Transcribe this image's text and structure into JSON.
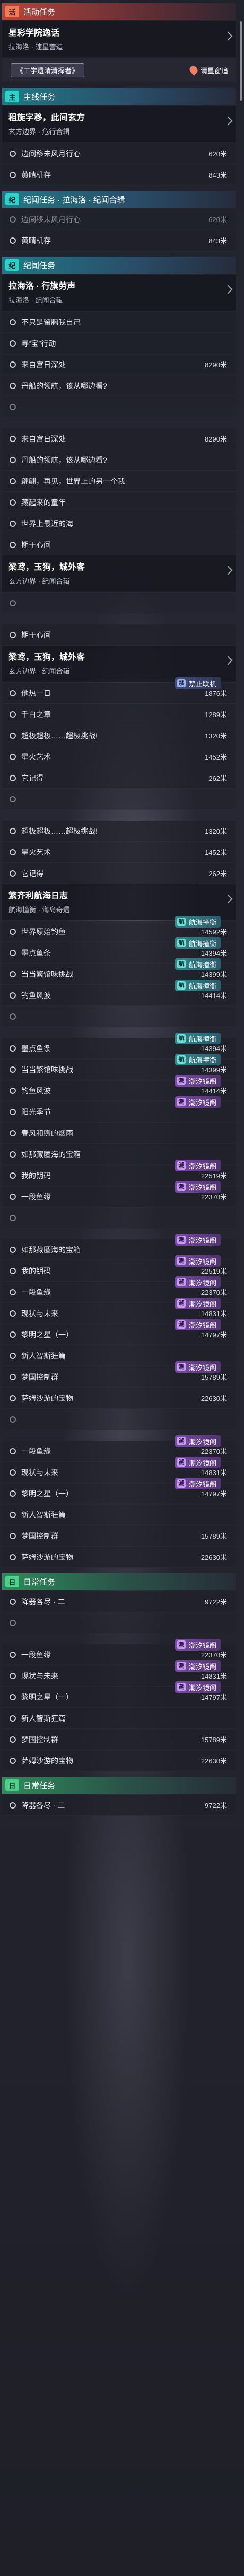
{
  "labels": {
    "event_header": "活动任务",
    "main_header": "主线任务",
    "story_header": "纪闻任务",
    "daily_header": "日常任务",
    "tag_event": "活",
    "tag_main": "主",
    "tag_story": "纪",
    "tag_daily": "日",
    "track_button": "请星窗追",
    "badge_net": "航海撞衡",
    "badge_tide": "潮汐镜阁",
    "badge_ban": "禁止联机"
  },
  "colors": {
    "event": "#b3463a",
    "main": "#1f7a86",
    "daily": "#2e8a5a",
    "accent_dot": "#c9ccd6"
  },
  "icons": {
    "obj_marker": "circle-outline-icon",
    "track": "map-pin-icon",
    "net": "compass-icon",
    "tide": "wave-icon",
    "ban": "lock-icon"
  },
  "rows": [
    {
      "kind": "hdr",
      "style": "event",
      "tag": "活",
      "text": "活动任务"
    },
    {
      "kind": "quest",
      "title": "星彩学院逸话",
      "sub": "拉海洛 · 速星营造"
    },
    {
      "kind": "btn",
      "chip": "《工学遗晴清探者》",
      "track": "请星窗追"
    },
    {
      "kind": "hdr",
      "style": "main",
      "tag": "主",
      "text": "主线任务"
    },
    {
      "kind": "quest",
      "title": "租旋字移，此间玄方",
      "sub": "玄方边界 · 危行合辑"
    },
    {
      "kind": "obj",
      "text": "边间移未风月行心",
      "dist": "620米"
    },
    {
      "kind": "obj",
      "text": "黄晴机存",
      "dist": "843米"
    },
    {
      "kind": "hdr",
      "style": "main",
      "tag": "纪",
      "text": "纪闻任务 · 拉海洛 · 纪闻合辑"
    },
    {
      "kind": "obj",
      "text": "边间移未风月行心",
      "dist": "620米",
      "dim": true
    },
    {
      "kind": "obj",
      "text": "黄晴机存",
      "dist": "843米"
    },
    {
      "kind": "hdr",
      "style": "main",
      "tag": "纪",
      "text": "纪闻任务"
    },
    {
      "kind": "quest",
      "title": "拉海洛 · 行旗劳声",
      "sub": "拉海洛 · 纪闻合辑"
    },
    {
      "kind": "obj",
      "text": "不只是留胸我自己",
      "dist": ""
    },
    {
      "kind": "obj",
      "text": "寻“宝”行动",
      "dist": ""
    },
    {
      "kind": "obj",
      "text": "来自宫日深处",
      "dist": "8290米"
    },
    {
      "kind": "obj",
      "text": "丹船的领航，该从哪边看?",
      "dist": ""
    },
    {
      "kind": "obj",
      "text": "",
      "dist": "",
      "dim": true
    },
    {
      "kind": "obj",
      "text": "来自宫日深处",
      "dist": "8290米"
    },
    {
      "kind": "obj",
      "text": "丹船的领航，该从哪边看?",
      "dist": ""
    },
    {
      "kind": "obj",
      "text": "翩翩，再见，世界上的另一个我",
      "dist": ""
    },
    {
      "kind": "obj",
      "text": "藏起来的童年",
      "dist": ""
    },
    {
      "kind": "obj",
      "text": "世界上最近的海",
      "dist": ""
    },
    {
      "kind": "obj",
      "text": "期于心间",
      "dist": ""
    },
    {
      "kind": "quest",
      "title": "梁鸢，玉狗，城外客",
      "sub": "玄方边界 · 纪闻合辑"
    },
    {
      "kind": "obj",
      "text": "",
      "dist": "",
      "dim": true
    },
    {
      "kind": "obj",
      "text": "期于心间",
      "dist": ""
    },
    {
      "kind": "quest",
      "title": "梁鸢，玉狗，城外客",
      "sub": "玄方边界 · 纪闻合辑"
    },
    {
      "kind": "obj",
      "text": "他热一日",
      "dist": "1876米",
      "badge": "ban"
    },
    {
      "kind": "obj",
      "text": "千白之章",
      "dist": "1289米"
    },
    {
      "kind": "obj",
      "text": "超极超极……超极挑战!",
      "dist": "1320米"
    },
    {
      "kind": "obj",
      "text": "星火艺术",
      "dist": "1452米"
    },
    {
      "kind": "obj",
      "text": "它记得",
      "dist": "262米"
    },
    {
      "kind": "obj",
      "text": "",
      "dist": "",
      "dim": true
    },
    {
      "kind": "obj",
      "text": "超极超极……超极挑战!",
      "dist": "1320米"
    },
    {
      "kind": "obj",
      "text": "星火艺术",
      "dist": "1452米"
    },
    {
      "kind": "obj",
      "text": "它记得",
      "dist": "262米"
    },
    {
      "kind": "quest",
      "title": "繁齐利航海日志",
      "sub": "航海撞衡 · 海岛奇遇"
    },
    {
      "kind": "obj",
      "text": "世界原始钓鱼",
      "dist": "14592米",
      "badge": "net"
    },
    {
      "kind": "obj",
      "text": "墨点鱼条",
      "dist": "14394米",
      "badge": "net"
    },
    {
      "kind": "obj",
      "text": "当当繁馆味挑战",
      "dist": "14399米",
      "badge": "net"
    },
    {
      "kind": "obj",
      "text": "钓鱼风波",
      "dist": "14414米",
      "badge": "net"
    },
    {
      "kind": "obj",
      "text": "",
      "dist": "",
      "dim": true
    },
    {
      "kind": "obj",
      "text": "墨点鱼条",
      "dist": "14394米",
      "badge": "net"
    },
    {
      "kind": "obj",
      "text": "当当繁馆味挑战",
      "dist": "14399米",
      "badge": "net"
    },
    {
      "kind": "obj",
      "text": "钓鱼风波",
      "dist": "14414米",
      "badge": "tide"
    },
    {
      "kind": "obj",
      "text": "阳光季节",
      "dist": "",
      "badge": "tide"
    },
    {
      "kind": "obj",
      "text": "春风和煦的烟雨",
      "dist": ""
    },
    {
      "kind": "obj",
      "text": "如那藏匿海的宝箱",
      "dist": ""
    },
    {
      "kind": "obj",
      "text": "我的钥码",
      "dist": "22519米",
      "badge": "tide"
    },
    {
      "kind": "obj",
      "text": "一段鱼缘",
      "dist": "22370米",
      "badge": "tide"
    },
    {
      "kind": "obj",
      "text": "",
      "dist": "",
      "dim": true
    },
    {
      "kind": "obj",
      "text": "如那藏匿海的宝箱",
      "dist": "",
      "badge": "tide"
    },
    {
      "kind": "obj",
      "text": "我的钥码",
      "dist": "22519米",
      "badge": "tide"
    },
    {
      "kind": "obj",
      "text": "一段鱼缘",
      "dist": "22370米",
      "badge": "tide"
    },
    {
      "kind": "obj",
      "text": "现状与未来",
      "dist": "14831米",
      "badge": "tide"
    },
    {
      "kind": "obj",
      "text": "黎明之星（一）",
      "dist": "14797米",
      "badge": "tide"
    },
    {
      "kind": "obj",
      "text": "新人智斯狂篇",
      "dist": ""
    },
    {
      "kind": "obj",
      "text": "梦国控制群",
      "dist": "15789米",
      "badge": "tide"
    },
    {
      "kind": "obj",
      "text": "萨姆沙游的宝物",
      "dist": "22630米"
    },
    {
      "kind": "obj",
      "text": "",
      "dist": "",
      "dim": true
    },
    {
      "kind": "obj",
      "text": "一段鱼缘",
      "dist": "22370米",
      "badge": "tide"
    },
    {
      "kind": "obj",
      "text": "现状与未来",
      "dist": "14831米",
      "badge": "tide"
    },
    {
      "kind": "obj",
      "text": "黎明之星（一）",
      "dist": "14797米",
      "badge": "tide"
    },
    {
      "kind": "obj",
      "text": "新人智斯狂篇",
      "dist": ""
    },
    {
      "kind": "obj",
      "text": "梦国控制群",
      "dist": "15789米"
    },
    {
      "kind": "obj",
      "text": "萨姆沙游的宝物",
      "dist": "22630米"
    },
    {
      "kind": "hdr",
      "style": "daily",
      "tag": "日",
      "text": "日常任务"
    },
    {
      "kind": "obj",
      "text": "降器各尽 · 二",
      "dist": "9722米"
    },
    {
      "kind": "obj",
      "text": "",
      "dist": "",
      "dim": true
    },
    {
      "kind": "obj",
      "text": "一段鱼缘",
      "dist": "22370米",
      "badge": "tide"
    },
    {
      "kind": "obj",
      "text": "现状与未来",
      "dist": "14831米",
      "badge": "tide"
    },
    {
      "kind": "obj",
      "text": "黎明之星（一）",
      "dist": "14797米",
      "badge": "tide"
    },
    {
      "kind": "obj",
      "text": "新人智斯狂篇",
      "dist": ""
    },
    {
      "kind": "obj",
      "text": "梦国控制群",
      "dist": "15789米"
    },
    {
      "kind": "obj",
      "text": "萨姆沙游的宝物",
      "dist": "22630米"
    },
    {
      "kind": "hdr",
      "style": "daily",
      "tag": "日",
      "text": "日常任务"
    },
    {
      "kind": "obj",
      "text": "降器各尽 · 二",
      "dist": "9722米"
    }
  ]
}
